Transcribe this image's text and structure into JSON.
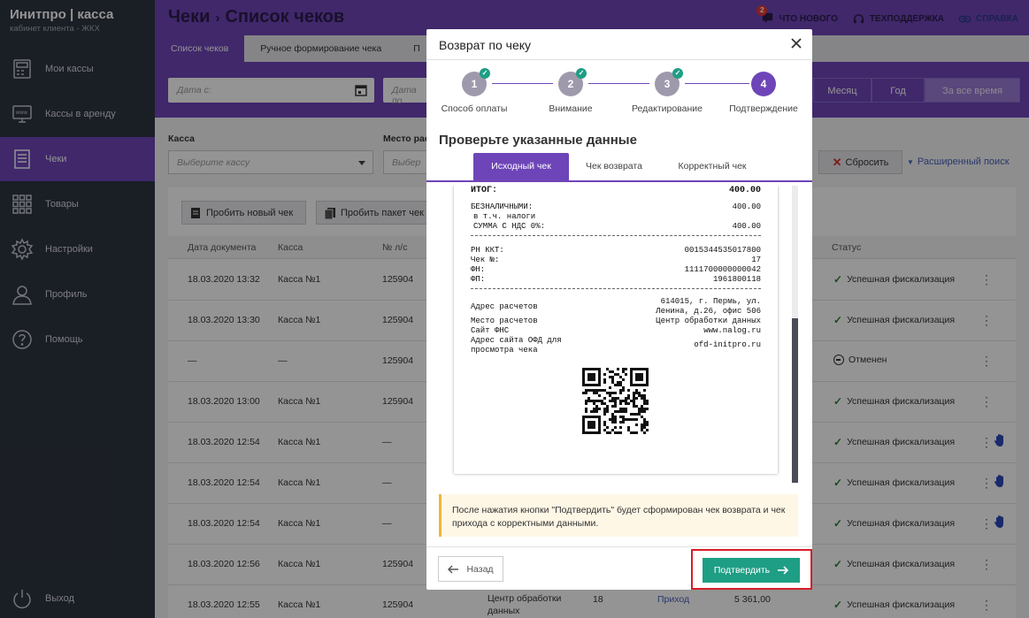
{
  "sidebar": {
    "logo_main": "Инитпро | касса",
    "logo_sub": "кабинет клиента - ЖКХ",
    "items": [
      {
        "label": "Мои кассы"
      },
      {
        "label": "Кассы в аренду"
      },
      {
        "label": "Чеки"
      },
      {
        "label": "Товары"
      },
      {
        "label": "Настройки"
      },
      {
        "label": "Профиль"
      },
      {
        "label": "Помощь"
      }
    ],
    "logout": "Выход"
  },
  "header": {
    "title_parent": "Чеки",
    "title_sep": "›",
    "title_current": "Список чеков",
    "whats_new": "ЧТО НОВОГО",
    "whats_new_badge": "2",
    "support": "ТЕХПОДДЕРЖКА",
    "help": "СПРАВКА"
  },
  "tabs": [
    {
      "label": "Список чеков"
    },
    {
      "label": "Ручное формирование чека"
    },
    {
      "label": "П"
    }
  ],
  "filters": {
    "date_from_placeholder": "Дата с:",
    "date_to_placeholder": "Дата по",
    "periods": [
      "Месяц",
      "Год",
      "За все время"
    ],
    "kassa_label": "Касса",
    "kassa_placeholder": "Выберите кассу",
    "place_label": "Место рас",
    "place_placeholder": "Выбер",
    "reset": "Сбросить",
    "advanced": "Расширенный поиск"
  },
  "actions": {
    "new_check": "Пробить новый чек",
    "batch": "Пробить пакет чек"
  },
  "table": {
    "headers": {
      "date": "Дата документа",
      "kassa": "Касса",
      "ls": "№ л/с",
      "status": "Статус"
    },
    "rows": [
      {
        "date": "18.03.2020 13:32",
        "kassa": "Касса №1",
        "ls": "125904",
        "status": "Успешная фискализация",
        "cancel": false,
        "hand": false
      },
      {
        "date": "18.03.2020 13:30",
        "kassa": "Касса №1",
        "ls": "125904",
        "status": "Успешная фискализация",
        "cancel": false,
        "hand": false
      },
      {
        "date": "—",
        "kassa": "—",
        "ls": "125904",
        "status": "Отменен",
        "cancel": true,
        "hand": false
      },
      {
        "date": "18.03.2020 13:00",
        "kassa": "Касса №1",
        "ls": "125904",
        "status": "Успешная фискализация",
        "cancel": false,
        "hand": false
      },
      {
        "date": "18.03.2020 12:54",
        "kassa": "Касса №1",
        "ls": "—",
        "status": "Успешная фискализация",
        "cancel": false,
        "hand": true
      },
      {
        "date": "18.03.2020 12:54",
        "kassa": "Касса №1",
        "ls": "—",
        "status": "Успешная фискализация",
        "cancel": false,
        "hand": true
      },
      {
        "date": "18.03.2020 12:54",
        "kassa": "Касса №1",
        "ls": "—",
        "status": "Успешная фискализация",
        "cancel": false,
        "hand": true
      },
      {
        "date": "18.03.2020 12:56",
        "kassa": "Касса №1",
        "ls": "125904",
        "status": "Успешная фискализация",
        "cancel": false,
        "hand": false
      },
      {
        "date": "18.03.2020 12:55",
        "kassa": "Касса №1",
        "ls": "125904",
        "status": "Успешная фискализация",
        "cancel": false,
        "hand": false,
        "place": "Центр обработки данных",
        "num": "18",
        "type": "Приход",
        "sum": "5 361,00"
      }
    ]
  },
  "modal": {
    "title": "Возврат по чеку",
    "steps": [
      {
        "num": "1",
        "label": "Способ оплаты",
        "done": true
      },
      {
        "num": "2",
        "label": "Внимание",
        "done": true
      },
      {
        "num": "3",
        "label": "Редактирование",
        "done": true
      },
      {
        "num": "4",
        "label": "Подтверждение",
        "done": false
      }
    ],
    "heading": "Проверьте указанные данные",
    "receipt_tabs": [
      "Исходный чек",
      "Чек возврата",
      "Корректный чек"
    ],
    "receipt": {
      "total_label": "ИТОГ:",
      "total_value": "400.00",
      "cashless_label": "БЕЗНАЛИЧНЫМИ:",
      "cashless_value": "400.00",
      "tax_label": "в т.ч. налоги",
      "vat_label": "СУММА С НДС 0%:",
      "vat_value": "400.00",
      "rn_label": "РН ККТ:",
      "rn_value": "0015344535017800",
      "check_no_label": "Чек №:",
      "check_no_value": "17",
      "fn_label": "ФН:",
      "fn_value": "1111700000000042",
      "fp_label": "ФП:",
      "fp_value": "1961800118",
      "addr_label": "Адрес расчетов",
      "addr_value_1": "614015, г. Пермь, ул.",
      "addr_value_2": "Ленина, д.26, офис 506",
      "place_label": "Место расчетов",
      "place_value": "Центр обработки данных",
      "fns_label": "Сайт ФНС",
      "fns_value": "www.nalog.ru",
      "ofd_label_1": "Адрес сайта ОФД для",
      "ofd_label_2": "просмотра чека",
      "ofd_value": "ofd-initpro.ru"
    },
    "warning": "После нажатия кнопки \"Подтвердить\" будет сформирован чек возврата и чек прихода с корректными данными.",
    "back": "Назад",
    "confirm": "Подтвердить"
  }
}
